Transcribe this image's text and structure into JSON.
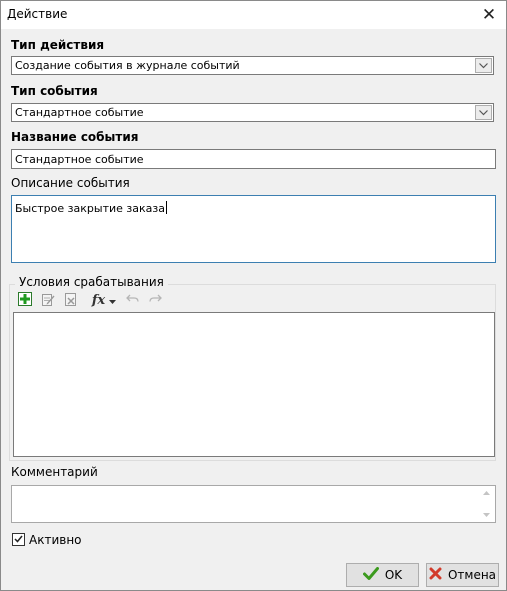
{
  "window": {
    "title": "Действие",
    "close_glyph": "✕"
  },
  "action_type": {
    "label": "Тип действия",
    "value": "Создание события в журнале событий"
  },
  "event_type": {
    "label": "Тип события",
    "value": "Стандартное событие"
  },
  "event_name": {
    "label": "Название события",
    "value": "Стандартное событие"
  },
  "event_description": {
    "label": "Описание события",
    "value": "Быстрое закрытие заказа"
  },
  "conditions": {
    "group_label": "Условия срабатывания",
    "toolbar": [
      {
        "name": "add",
        "icon": "plus-icon",
        "color": "#1f9a1f"
      },
      {
        "name": "edit",
        "icon": "edit-icon"
      },
      {
        "name": "delete",
        "icon": "delete-icon"
      },
      {
        "name": "function",
        "icon": "fx-icon",
        "label": "fx"
      },
      {
        "name": "undo",
        "icon": "undo-icon"
      },
      {
        "name": "redo",
        "icon": "redo-icon"
      }
    ]
  },
  "comment": {
    "label": "Комментарий",
    "value": ""
  },
  "active": {
    "label": "Активно",
    "checked": true
  },
  "buttons": {
    "ok": {
      "label": "OK",
      "icon": "checkmark-icon",
      "color": "#3b9a1d"
    },
    "cancel": {
      "label": "Отмена",
      "icon": "cross-icon",
      "color": "#d23a2a"
    }
  }
}
